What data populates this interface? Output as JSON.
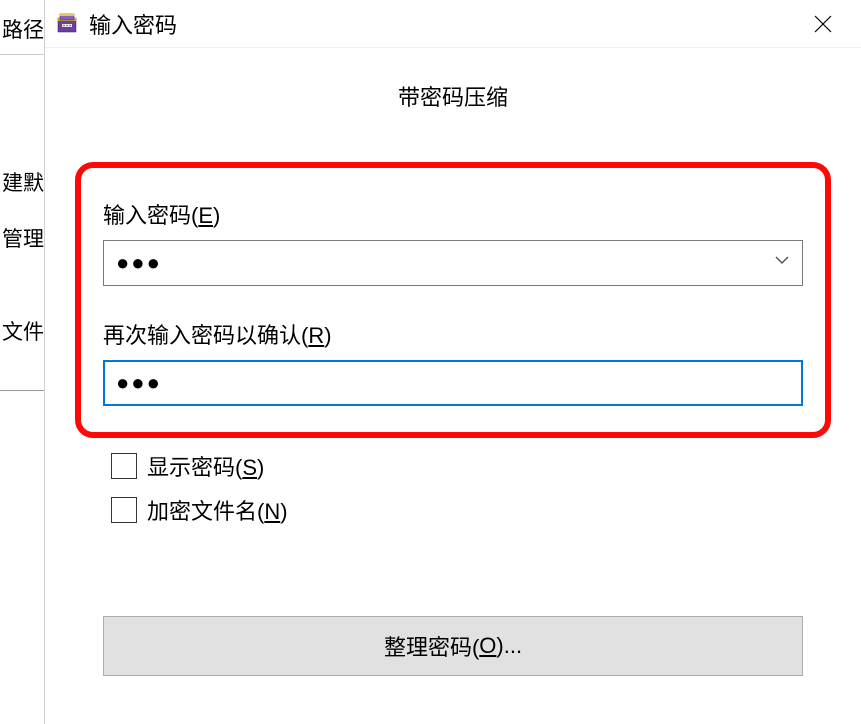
{
  "background": {
    "label1": "路径",
    "label2": "建默",
    "label3": "管理",
    "label4": "文件"
  },
  "dialog": {
    "title": "输入密码",
    "subtitle": "带密码压缩",
    "password_label_pre": "输入密码(",
    "password_label_key": "E",
    "password_label_post": ")",
    "password_value": "●●●",
    "confirm_label_pre": "再次输入密码以确认(",
    "confirm_label_key": "R",
    "confirm_label_post": ")",
    "confirm_value": "●●●",
    "show_password_pre": "显示密码(",
    "show_password_key": "S",
    "show_password_post": ")",
    "encrypt_names_pre": "加密文件名(",
    "encrypt_names_key": "N",
    "encrypt_names_post": ")",
    "organize_pre": "整理密码(",
    "organize_key": "O",
    "organize_post": ")..."
  }
}
